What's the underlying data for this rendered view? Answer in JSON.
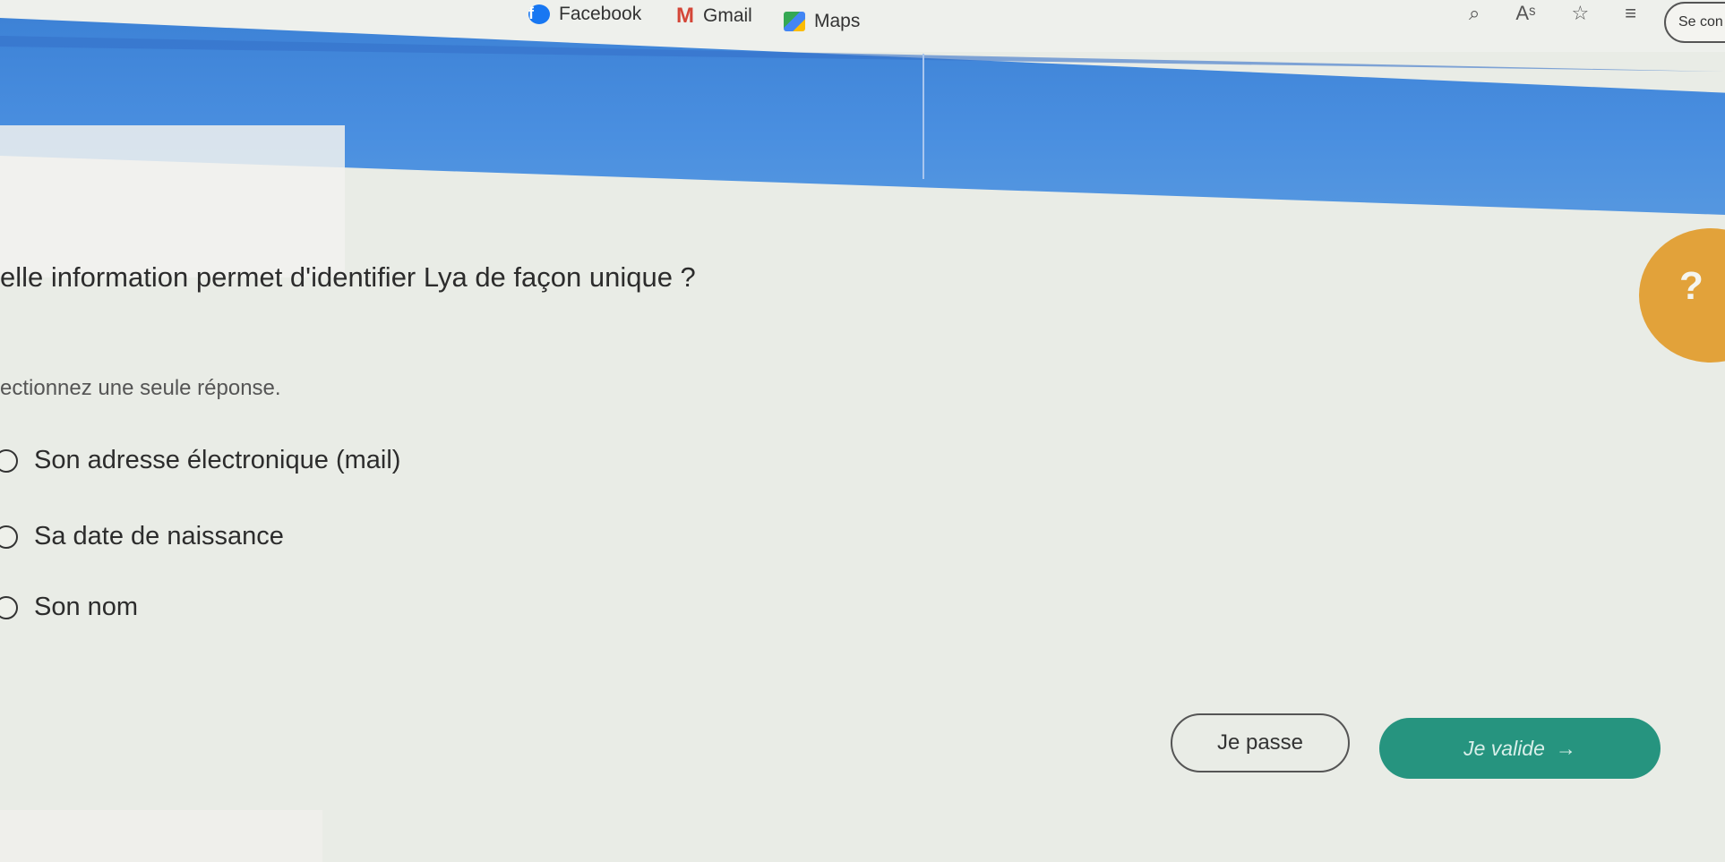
{
  "bookmarks": [
    {
      "label": "Facebook",
      "icon": "facebook-icon"
    },
    {
      "label": "Gmail",
      "icon": "gmail-icon"
    },
    {
      "label": "Maps",
      "icon": "maps-icon"
    }
  ],
  "browser": {
    "signin_label": "Se con"
  },
  "quiz": {
    "question": "elle information permet d'identifier Lya de façon unique ?",
    "instruction": "ectionnez une seule réponse.",
    "options": [
      {
        "label": "Son adresse électronique (mail)"
      },
      {
        "label": "Sa date de naissance"
      },
      {
        "label": "Son nom"
      }
    ],
    "hint_symbol": "?"
  },
  "actions": {
    "skip_label": "Je passe",
    "validate_label": "Je valide",
    "validate_arrow": "→"
  },
  "colors": {
    "header_blue": "#4a8fe0",
    "validate_green": "#26947f",
    "hint_orange": "#e2a23a"
  }
}
